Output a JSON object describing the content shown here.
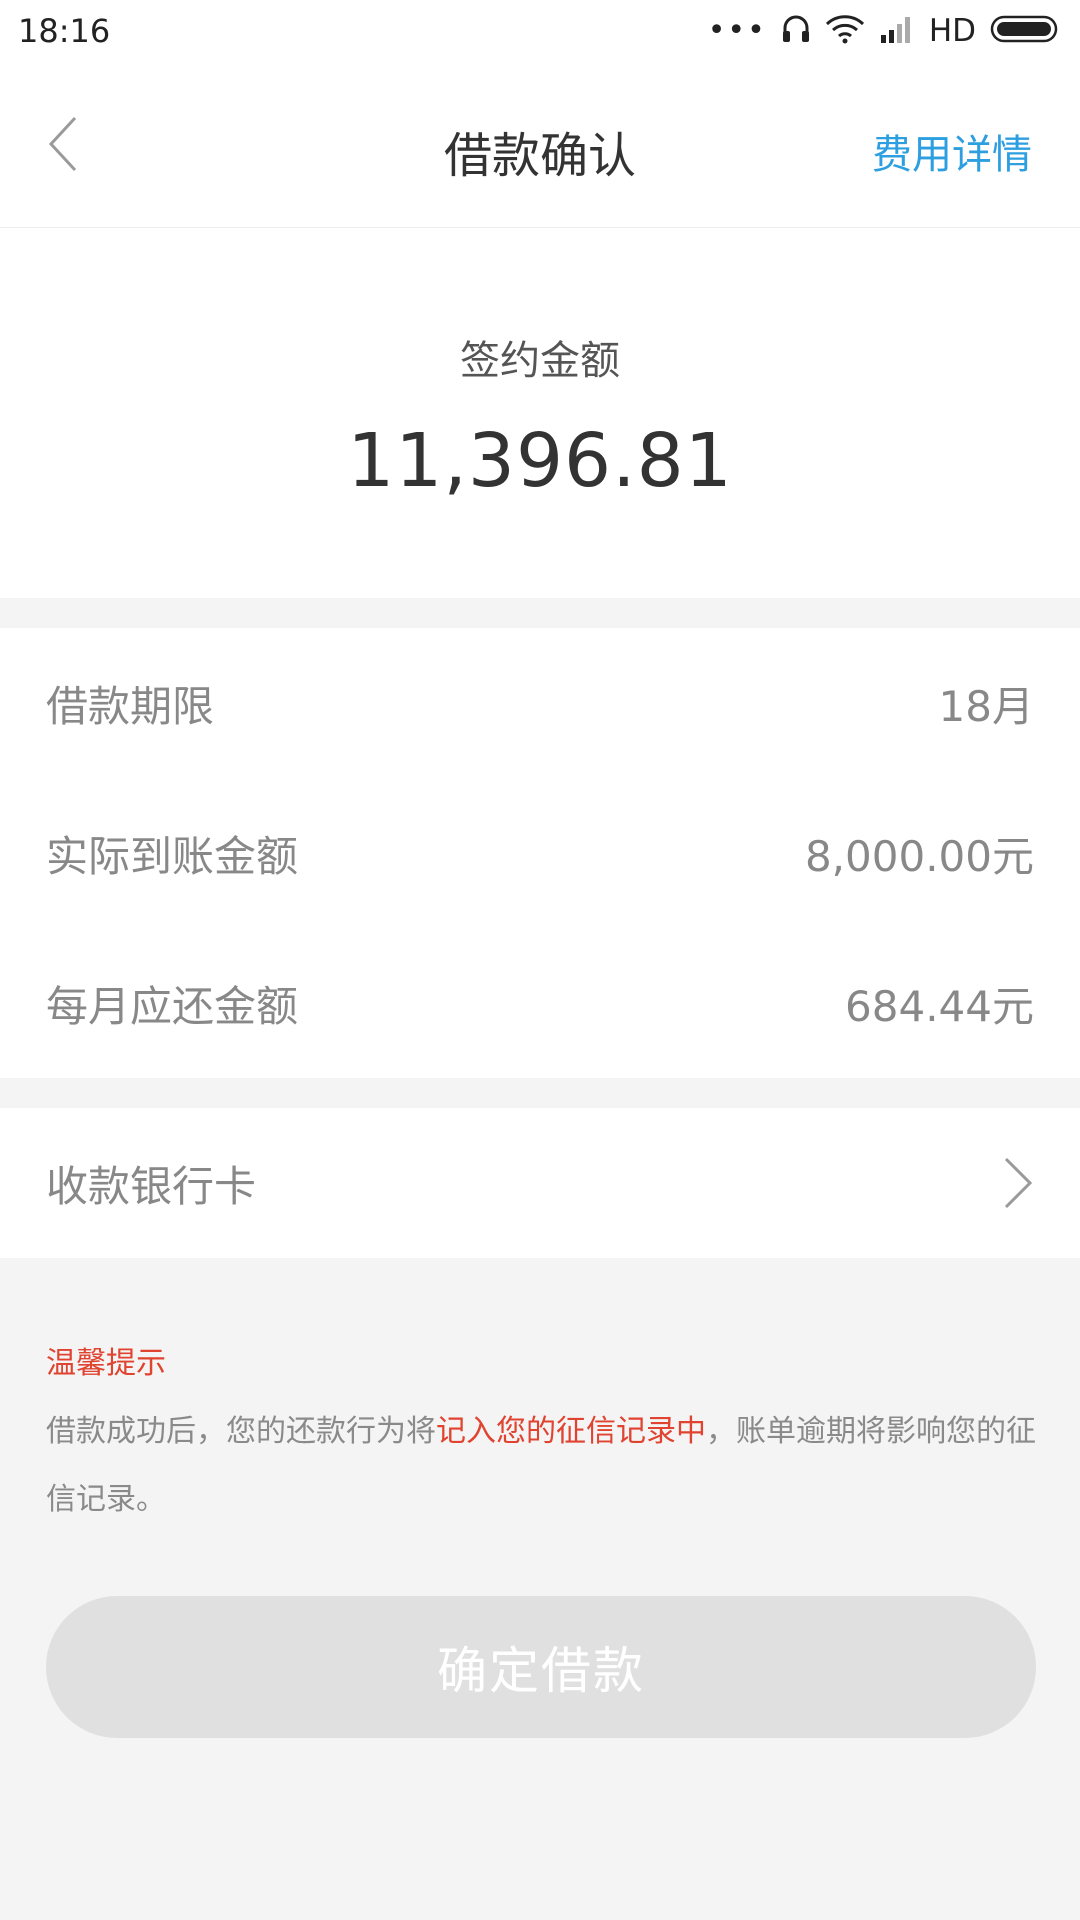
{
  "status_bar": {
    "time": "18:16",
    "dots": "•••",
    "network_label": "HD",
    "icons": [
      "headset-icon",
      "wifi-icon",
      "signal-icon",
      "battery-icon"
    ]
  },
  "header": {
    "back_icon": "chevron-left-icon",
    "title": "借款确认",
    "action": "费用详情"
  },
  "amount": {
    "label": "签约金额",
    "value": "11,396.81"
  },
  "details": [
    {
      "label": "借款期限",
      "value": "18月"
    },
    {
      "label": "实际到账金额",
      "value": "8,000.00元"
    },
    {
      "label": "每月应还金额",
      "value": "684.44元"
    }
  ],
  "bank_card": {
    "label": "收款银行卡",
    "icon": "chevron-right-icon"
  },
  "notice": {
    "title": "温馨提示",
    "text_before": "借款成功后，您的还款行为将",
    "text_highlight": "记入您的征信记录中",
    "text_after": "，账单逾期将影响您的征信记录。"
  },
  "confirm_button": {
    "label": "确定借款"
  },
  "colors": {
    "accent": "#2d9fe0",
    "warning": "#e0432f",
    "button_disabled": "#e0e0e0",
    "background": "#f4f4f4"
  }
}
